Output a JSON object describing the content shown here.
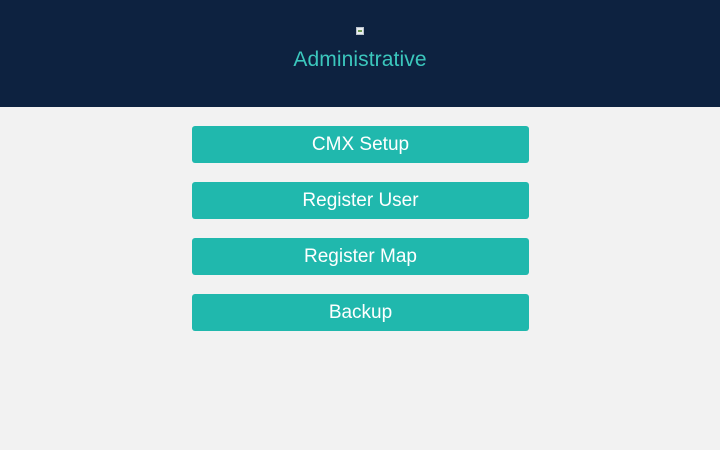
{
  "header": {
    "title": "Administrative",
    "logo_icon": "broken-image-icon"
  },
  "menu": {
    "buttons": [
      {
        "label": "CMX Setup"
      },
      {
        "label": "Register User"
      },
      {
        "label": "Register Map"
      },
      {
        "label": "Backup"
      }
    ]
  },
  "colors": {
    "header_background": "#0d2240",
    "title_text": "#3bc7bd",
    "button_background": "#20b8ad",
    "page_background": "#f2f2f2",
    "button_text": "#ffffff"
  }
}
